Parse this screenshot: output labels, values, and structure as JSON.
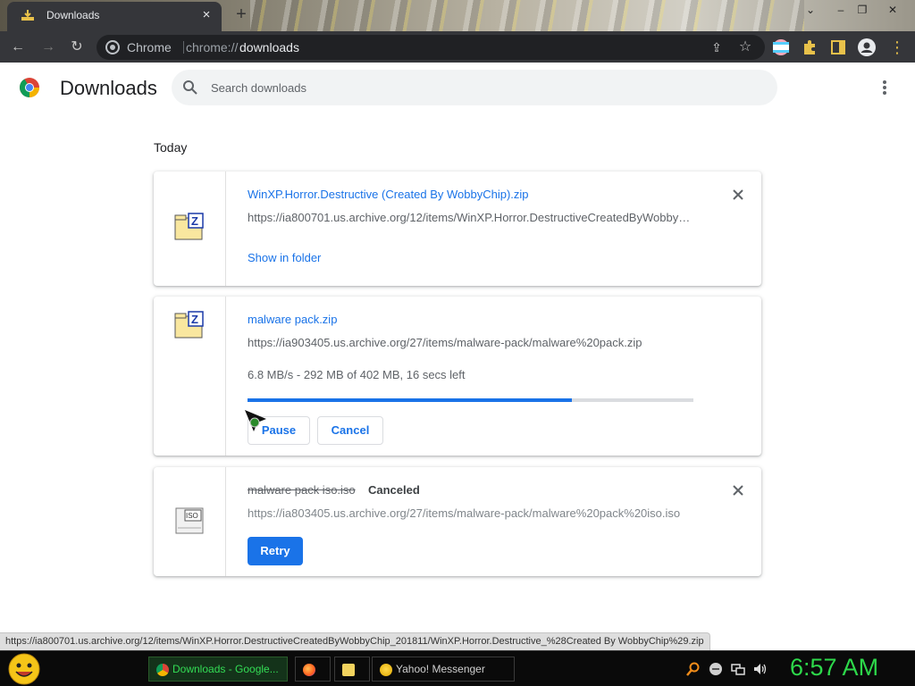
{
  "tab": {
    "title": "Downloads",
    "close": "×",
    "new_tab": "+"
  },
  "window_controls": {
    "minimize": "–",
    "restore": "❐",
    "close": "✕",
    "chevron": "⌄"
  },
  "toolbar": {
    "back": "←",
    "forward": "→",
    "reload": "↻",
    "chip_label": "Chrome",
    "url_scheme": "chrome://",
    "url_host": "downloads",
    "share": "⇪",
    "star": "☆",
    "menu": "⋮"
  },
  "downloads_page": {
    "title": "Downloads",
    "search_placeholder": "Search downloads",
    "date_heading": "Today"
  },
  "downloads": [
    {
      "filename": "WinXP.Horror.Destructive (Created By WobbyChip).zip",
      "url": "https://ia800701.us.archive.org/12/items/WinXP.Horror.DestructiveCreatedByWobbyChip_201811/WinXP.Horror.Destructive%20%28Created%20By%20WobbyChip%29.zip",
      "action_link": "Show in folder",
      "remove_label": "×"
    },
    {
      "filename": "malware pack.zip",
      "url": "https://ia903405.us.archive.org/27/items/malware-pack/malware%20pack.zip",
      "progress_text": "6.8 MB/s - 292 MB of 402 MB, 16 secs left",
      "progress_fraction": 0.727,
      "pause_label": "Pause",
      "cancel_label": "Cancel"
    },
    {
      "filename": "malware pack iso.iso",
      "status": "Canceled",
      "url": "https://ia803405.us.archive.org/27/items/malware-pack/malware%20pack%20iso.iso",
      "retry_label": "Retry",
      "remove_label": "×"
    }
  ],
  "status_bubble": "https://ia800701.us.archive.org/12/items/WinXP.Horror.DestructiveCreatedByWobbyChip_201811/WinXP.Horror.Destructive_%28Created By WobbyChip%29.zip",
  "taskbar": {
    "items": [
      {
        "label": "Downloads - Google...",
        "icon": "chrome-icon"
      },
      {
        "label": "",
        "icon": "firefox-icon"
      },
      {
        "label": "",
        "icon": "folder-icon"
      },
      {
        "label": "Yahoo! Messenger",
        "icon": "yahoo-messenger-icon"
      }
    ],
    "clock": "6:57 AM"
  },
  "colors": {
    "accent": "#1a73e8",
    "toolbar_bg": "#35363a",
    "clock_green": "#2dd84a"
  }
}
